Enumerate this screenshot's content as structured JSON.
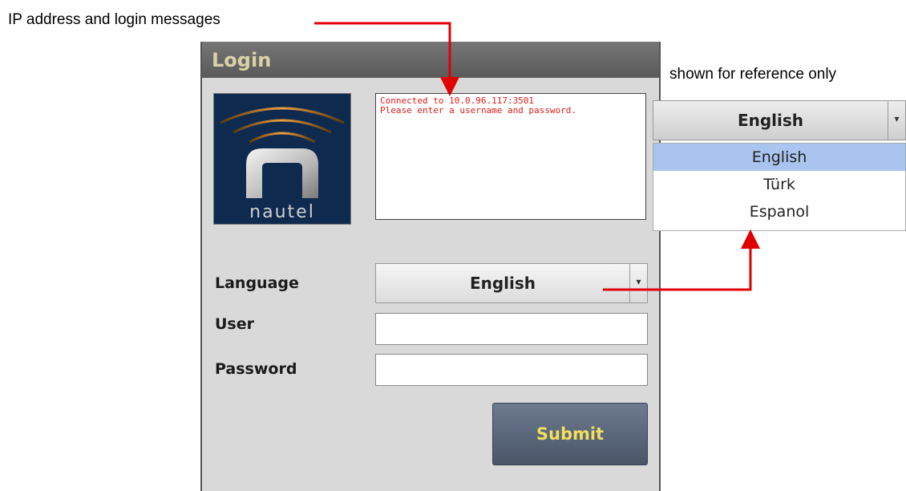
{
  "annotations": {
    "top_note": "IP address and login messages",
    "reference_note": "shown for reference only"
  },
  "login": {
    "title": "Login",
    "logo_text": "nautel",
    "messages": [
      "Connected to 10.0.96.117:3501",
      "Please enter a username and password."
    ],
    "language_label": "Language",
    "language_value": "English",
    "user_label": "User",
    "user_value": "",
    "password_label": "Password",
    "password_value": "",
    "submit_label": "Submit"
  },
  "language_reference": {
    "selected": "English",
    "options": [
      "English",
      "Türk",
      "Espanol"
    ]
  },
  "colors": {
    "annotation_arrow": "#e00000",
    "title_text": "#d9d2a4",
    "submit_text": "#f2df5c",
    "message_text": "#e01b1b",
    "selected_option_bg": "#a9c4ee"
  }
}
